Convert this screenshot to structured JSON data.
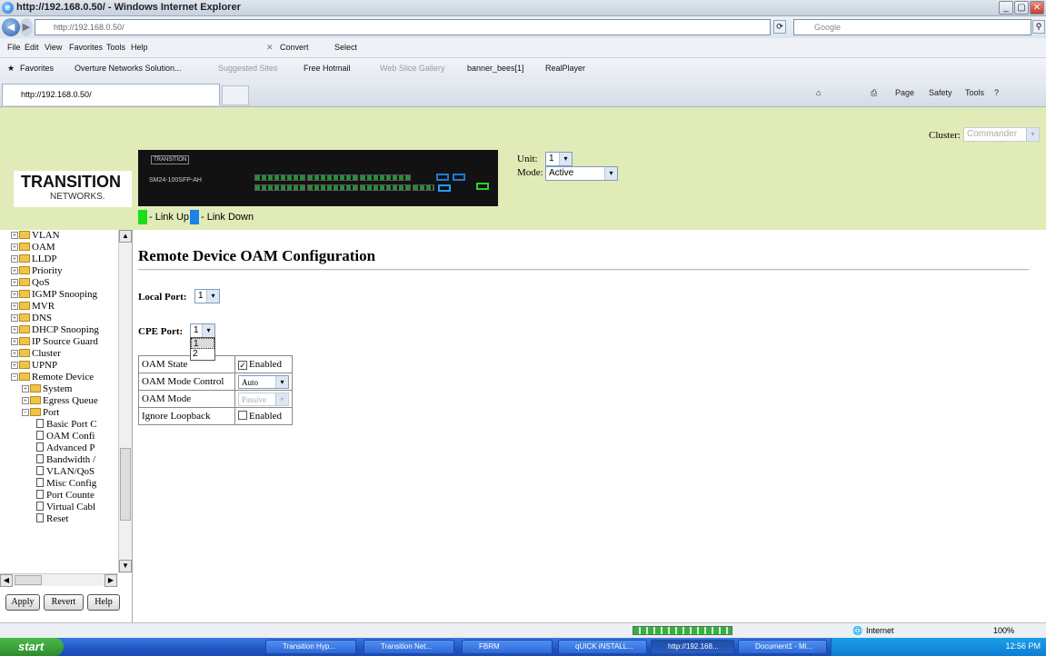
{
  "browser": {
    "window_title": "http://192.168.0.50/ - Windows Internet Explorer",
    "address": "http://192.168.0.50/",
    "search_placeholder": "Google",
    "menu": [
      "File",
      "Edit",
      "View",
      "Favorites",
      "Tools",
      "Help"
    ],
    "convert_label": "Convert",
    "select_label": "Select",
    "favorites_label": "Favorites",
    "favorites_links": [
      "Overture Networks Solution...",
      "Suggested Sites",
      "Free Hotmail",
      "Web Slice Gallery",
      "banner_bees[1]",
      "RealPlayer"
    ],
    "tab_title": "http://192.168.0.50/",
    "command_bar": [
      "Page",
      "Safety",
      "Tools"
    ],
    "status_zone": "Internet",
    "zoom": "100%"
  },
  "header": {
    "logo_main": "TRANSITION",
    "logo_sub": "NETWORKS.",
    "switch_brand": "TRANSITION",
    "switch_model": "SM24-100SFP-AH",
    "legend_up": "- Link Up",
    "legend_down": "- Link Down",
    "cluster_label": "Cluster:",
    "cluster_value": "Commander",
    "unit_label": "Unit:",
    "unit_value": "1",
    "mode_label": "Mode:",
    "mode_value": "Active"
  },
  "sidebar": {
    "top_items": [
      "VLAN",
      "OAM",
      "LLDP",
      "Priority",
      "QoS",
      "IGMP Snooping",
      "MVR",
      "DNS",
      "DHCP Snooping",
      "IP Source Guard",
      "Cluster",
      "UPNP"
    ],
    "remote_device": "Remote Device",
    "remote_children": [
      "System",
      "Egress Queue"
    ],
    "port": "Port",
    "port_children": [
      "Basic Port C",
      "OAM Confi",
      "Advanced P",
      "Bandwidth /",
      "VLAN/QoS",
      "Misc Config",
      "Port Counte",
      "Virtual Cabl",
      "Reset"
    ],
    "buttons": {
      "apply": "Apply",
      "revert": "Revert",
      "help": "Help"
    }
  },
  "main": {
    "title": "Remote Device OAM Configuration",
    "local_port_label": "Local Port:",
    "local_port_value": "1",
    "cpe_port_label": "CPE Port:",
    "cpe_port_value": "1",
    "cpe_options": [
      "1",
      "2"
    ],
    "rows": [
      {
        "label": "OAM State",
        "value": "Enabled",
        "checked": true
      },
      {
        "label": "OAM Mode Control",
        "value": "Auto"
      },
      {
        "label": "OAM Mode",
        "value": "Passive"
      },
      {
        "label": "Ignore Loopback",
        "value": "Enabled",
        "checked": false
      }
    ]
  },
  "taskbar": {
    "start": "start",
    "tasks": [
      "Transition Hyp...",
      "Transition Net...",
      "FBRM",
      "qUICK iNSTALL...",
      "http://192.168...",
      "Document1 - Mi..."
    ],
    "clock": "12:56 PM"
  }
}
